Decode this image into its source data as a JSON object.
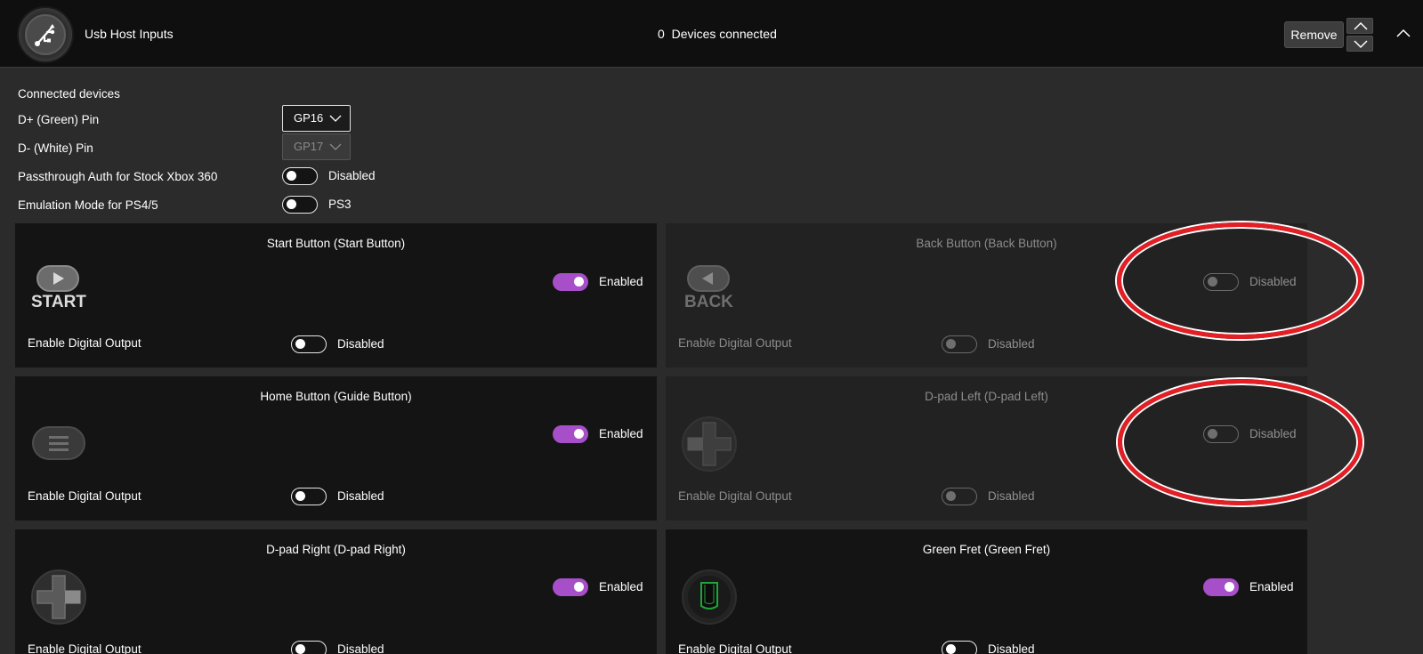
{
  "header": {
    "title": "Usb Host Inputs",
    "device_count": "0",
    "device_count_label": "Devices connected",
    "remove_label": "Remove"
  },
  "settings": {
    "connected_devices_label": "Connected devices",
    "dplus_label": "D+ (Green) Pin",
    "dplus_value": "GP16",
    "dminus_label": "D- (White) Pin",
    "dminus_value": "GP17",
    "passthrough_label": "Passthrough Auth for Stock Xbox 360",
    "passthrough_value": "Disabled",
    "emulation_label": "Emulation Mode for PS4/5",
    "emulation_value": "PS3"
  },
  "cards": [
    {
      "title": "Start Button (Start Button)",
      "icon": "start-button-icon",
      "icon_text": "START",
      "state": "Enabled",
      "output_label": "Enable Digital Output",
      "output_state": "Disabled"
    },
    {
      "title": "Back Button (Back Button)",
      "icon": "back-button-icon",
      "icon_text": "BACK",
      "state": "Disabled",
      "output_label": "Enable Digital Output",
      "output_state": "Disabled"
    },
    {
      "title": "Home Button (Guide Button)",
      "icon": "guide-button-icon",
      "state": "Enabled",
      "output_label": "Enable Digital Output",
      "output_state": "Disabled"
    },
    {
      "title": "D-pad Left (D-pad Left)",
      "icon": "dpad-left-icon",
      "state": "Disabled",
      "output_label": "Enable Digital Output",
      "output_state": "Disabled"
    },
    {
      "title": "D-pad Right (D-pad Right)",
      "icon": "dpad-right-icon",
      "state": "Enabled",
      "output_label": "Enable Digital Output",
      "output_state": "Disabled"
    },
    {
      "title": "Green Fret (Green Fret)",
      "icon": "green-fret-icon",
      "state": "Enabled",
      "output_label": "Enable Digital Output",
      "output_state": "Disabled"
    }
  ],
  "colors": {
    "accent": "#a64fc9",
    "highlight_ring": "#e31e24",
    "green_fret": "#1fa538"
  }
}
